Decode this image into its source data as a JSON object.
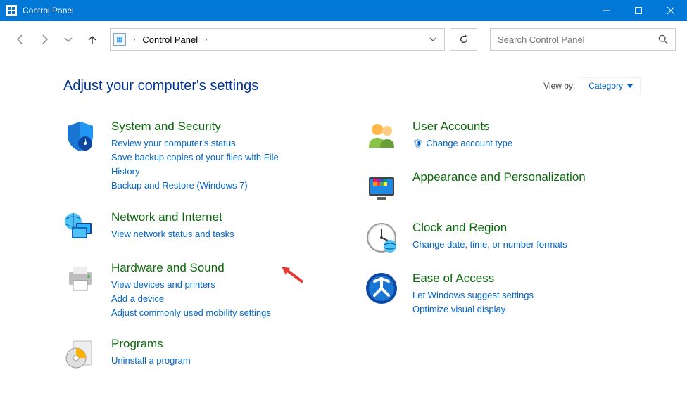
{
  "window": {
    "title": "Control Panel"
  },
  "breadcrumb": {
    "item1": "Control Panel"
  },
  "refresh": "⟳",
  "search": {
    "placeholder": "Search Control Panel"
  },
  "header": {
    "title": "Adjust your computer's settings",
    "view_by_label": "View by:",
    "view_by_value": "Category"
  },
  "left": {
    "c1": {
      "title": "System and Security",
      "l1": "Review your computer's status",
      "l2": "Save backup copies of your files with File History",
      "l3": "Backup and Restore (Windows 7)"
    },
    "c2": {
      "title": "Network and Internet",
      "l1": "View network status and tasks"
    },
    "c3": {
      "title": "Hardware and Sound",
      "l1": "View devices and printers",
      "l2": "Add a device",
      "l3": "Adjust commonly used mobility settings"
    },
    "c4": {
      "title": "Programs",
      "l1": "Uninstall a program"
    }
  },
  "right": {
    "c1": {
      "title": "User Accounts",
      "l1": "Change account type"
    },
    "c2": {
      "title": "Appearance and Personalization"
    },
    "c3": {
      "title": "Clock and Region",
      "l1": "Change date, time, or number formats"
    },
    "c4": {
      "title": "Ease of Access",
      "l1": "Let Windows suggest settings",
      "l2": "Optimize visual display"
    }
  }
}
